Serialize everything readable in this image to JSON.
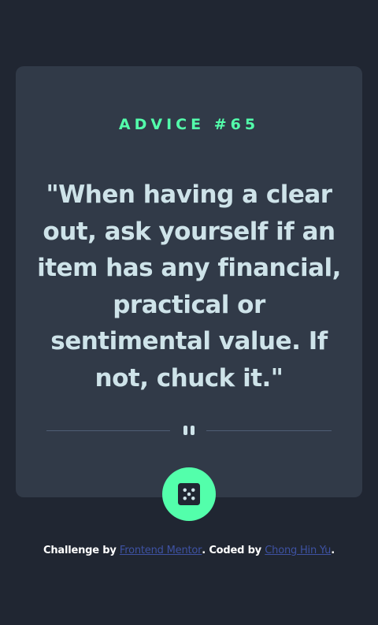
{
  "card": {
    "advice_label": "ADVICE #65",
    "quote": "\"When having a clear out, ask yourself if an item has any financial, practical or sentimental value. If not, chuck it.\""
  },
  "icons": {
    "divider": "pause-icon",
    "button": "dice-icon"
  },
  "attribution": {
    "prefix": "Challenge by ",
    "link1": "Frontend Mentor",
    "middle": ". Coded by ",
    "link2": "Chong Hin Yu",
    "suffix": "."
  },
  "colors": {
    "background": "#202632",
    "card": "#313a48",
    "accent": "#53ffab",
    "quote_text": "#cee3e9",
    "divider": "#4f5d74",
    "link": "#3e52a3"
  }
}
